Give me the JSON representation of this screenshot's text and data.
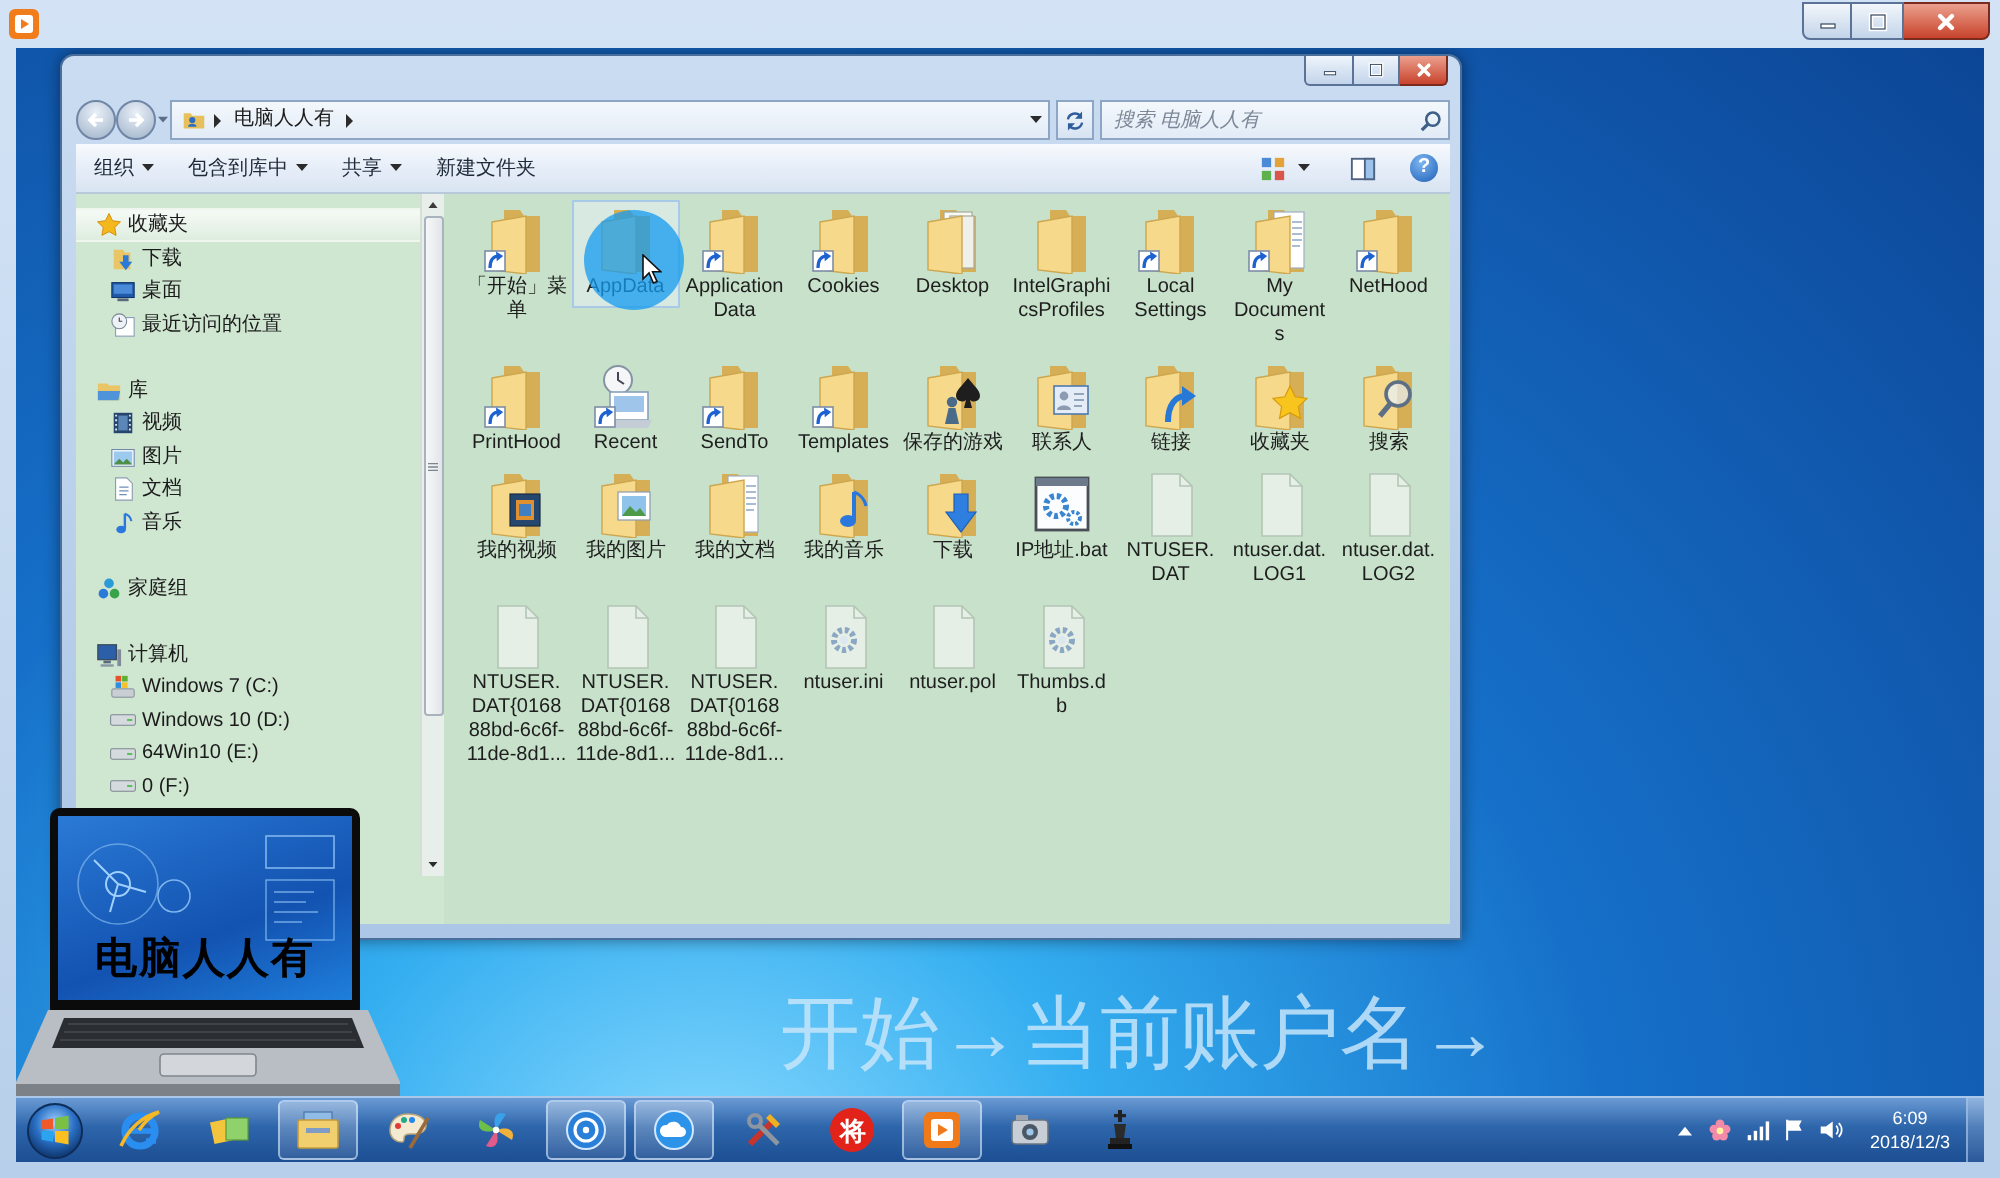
{
  "explorer": {
    "breadcrumbs": [
      "电脑人人有"
    ],
    "search": {
      "placeholder": "搜索 电脑人人有"
    },
    "toolbar": [
      {
        "label": "组织",
        "dropdown": true
      },
      {
        "label": "包含到库中",
        "dropdown": true
      },
      {
        "label": "共享",
        "dropdown": true
      },
      {
        "label": "新建文件夹",
        "dropdown": false
      }
    ],
    "help": "?",
    "nav_pane": [
      {
        "label": "收藏夹",
        "kind": "favorites",
        "selected": true,
        "children": [
          {
            "label": "下载",
            "kind": "downloads",
            "selected": false
          },
          {
            "label": "桌面",
            "kind": "desktop",
            "selected": false
          },
          {
            "label": "最近访问的位置",
            "kind": "recent",
            "selected": false
          }
        ]
      },
      {
        "label": "库",
        "kind": "library",
        "selected": false,
        "children": [
          {
            "label": "视频",
            "kind": "video",
            "selected": false
          },
          {
            "label": "图片",
            "kind": "picture",
            "selected": false
          },
          {
            "label": "文档",
            "kind": "document",
            "selected": false
          },
          {
            "label": "音乐",
            "kind": "music",
            "selected": false
          }
        ]
      },
      {
        "label": "家庭组",
        "kind": "homegroup",
        "selected": false
      },
      {
        "label": "计算机",
        "kind": "computer",
        "selected": false,
        "children": [
          {
            "label": "Windows 7 (C:)",
            "kind": "drive-os",
            "selected": false
          },
          {
            "label": "Windows 10 (D:)",
            "kind": "drive",
            "selected": false
          },
          {
            "label": "64Win10 (E:)",
            "kind": "drive",
            "selected": false
          },
          {
            "label": "0 (F:)",
            "kind": "drive",
            "selected": false
          }
        ]
      }
    ],
    "files": [
      {
        "name": "「开始」菜单",
        "kind": "folder",
        "shortcut": true,
        "selected": false
      },
      {
        "name": "AppData",
        "kind": "folder",
        "shortcut": false,
        "selected": true
      },
      {
        "name": "Application Data",
        "kind": "folder",
        "shortcut": true,
        "selected": false
      },
      {
        "name": "Cookies",
        "kind": "folder",
        "shortcut": true,
        "selected": false
      },
      {
        "name": "Desktop",
        "kind": "folder-papers",
        "shortcut": false,
        "selected": false
      },
      {
        "name": "IntelGraphicsProfiles",
        "kind": "folder",
        "shortcut": false,
        "selected": false
      },
      {
        "name": "Local Settings",
        "kind": "folder",
        "shortcut": true,
        "selected": false
      },
      {
        "name": "My Documents",
        "kind": "folder-document",
        "shortcut": true,
        "selected": false
      },
      {
        "name": "NetHood",
        "kind": "folder",
        "shortcut": true,
        "selected": false
      },
      {
        "name": "PrintHood",
        "kind": "folder",
        "shortcut": true,
        "selected": false
      },
      {
        "name": "Recent",
        "kind": "recent",
        "shortcut": true,
        "selected": false
      },
      {
        "name": "SendTo",
        "kind": "folder",
        "shortcut": true,
        "selected": false
      },
      {
        "name": "Templates",
        "kind": "folder",
        "shortcut": true,
        "selected": false
      },
      {
        "name": "保存的游戏",
        "kind": "folder-game",
        "shortcut": false,
        "selected": false
      },
      {
        "name": "联系人",
        "kind": "folder-contacts",
        "shortcut": false,
        "selected": false
      },
      {
        "name": "链接",
        "kind": "folder-links",
        "shortcut": false,
        "selected": false
      },
      {
        "name": "收藏夹",
        "kind": "folder-favorites",
        "shortcut": false,
        "selected": false
      },
      {
        "name": "搜索",
        "kind": "folder-search",
        "shortcut": false,
        "selected": false
      },
      {
        "name": "我的视频",
        "kind": "folder-video",
        "shortcut": false,
        "selected": false
      },
      {
        "name": "我的图片",
        "kind": "folder-picture",
        "shortcut": false,
        "selected": false
      },
      {
        "name": "我的文档",
        "kind": "folder-document",
        "shortcut": false,
        "selected": false
      },
      {
        "name": "我的音乐",
        "kind": "folder-music",
        "shortcut": false,
        "selected": false
      },
      {
        "name": "下载",
        "kind": "folder-download",
        "shortcut": false,
        "selected": false
      },
      {
        "name": "IP地址.bat",
        "kind": "batch",
        "shortcut": false,
        "selected": false
      },
      {
        "name": "NTUSER.DAT",
        "kind": "file",
        "shortcut": false,
        "selected": false
      },
      {
        "name": "ntuser.dat.LOG1",
        "kind": "file",
        "shortcut": false,
        "selected": false
      },
      {
        "name": "ntuser.dat.LOG2",
        "kind": "file",
        "shortcut": false,
        "selected": false
      },
      {
        "name": "NTUSER.DAT{016888bd-6c6f-11de-8d1...",
        "kind": "file",
        "shortcut": false,
        "selected": false
      },
      {
        "name": "NTUSER.DAT{016888bd-6c6f-11de-8d1...",
        "kind": "file",
        "shortcut": false,
        "selected": false
      },
      {
        "name": "NTUSER.DAT{016888bd-6c6f-11de-8d1...",
        "kind": "file",
        "shortcut": false,
        "selected": false
      },
      {
        "name": "ntuser.ini",
        "kind": "config",
        "shortcut": false,
        "selected": false
      },
      {
        "name": "ntuser.pol",
        "kind": "file",
        "shortcut": false,
        "selected": false
      },
      {
        "name": "Thumbs.db",
        "kind": "config",
        "shortcut": false,
        "selected": false
      }
    ]
  },
  "logo": {
    "text": "电脑人人有"
  },
  "caption": "开始→当前账户名→",
  "taskbar": {
    "apps": [
      {
        "kind": "browser",
        "running": false
      },
      {
        "kind": "tiles",
        "running": false
      },
      {
        "kind": "explorer",
        "running": true
      },
      {
        "kind": "paint",
        "running": false
      },
      {
        "kind": "pinwheel",
        "running": false
      },
      {
        "kind": "disc",
        "running": true
      },
      {
        "kind": "cloud",
        "running": true
      },
      {
        "kind": "tools",
        "running": false
      },
      {
        "kind": "piece",
        "glyph": "将",
        "running": false
      },
      {
        "kind": "player",
        "running": true
      },
      {
        "kind": "camera",
        "running": false
      },
      {
        "kind": "chess",
        "running": false
      }
    ],
    "clock": {
      "time": "6:09",
      "date": "2018/12/3"
    }
  }
}
